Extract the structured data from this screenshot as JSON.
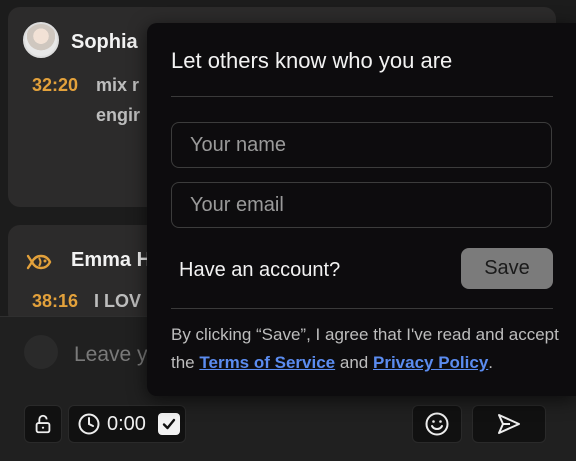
{
  "comments": [
    {
      "author": "Sophia",
      "timestamp": "32:20",
      "text_visible": "mix r engir"
    },
    {
      "author": "Emma H",
      "timestamp": "38:16",
      "text_visible": "I LOV"
    }
  ],
  "composer": {
    "placeholder": "Leave y",
    "time_value": "0:00"
  },
  "popover": {
    "title": "Let others know who you are",
    "name_placeholder": "Your name",
    "email_placeholder": "Your email",
    "account_link": "Have an account?",
    "save_label": "Save",
    "legal_prefix": "By clicking “Save”, I agree that I've read and accept the",
    "terms_label": "Terms of Service",
    "legal_and": "and",
    "privacy_label": "Privacy Policy",
    "legal_suffix": "."
  },
  "colors": {
    "timestamp": "#e3a13b",
    "link": "#5b8cf0",
    "save_bg": "#7b7b7b"
  },
  "icons": [
    "fish-icon",
    "unlock-icon",
    "clock-icon",
    "checkmark-icon",
    "smiley-icon",
    "send-icon"
  ]
}
